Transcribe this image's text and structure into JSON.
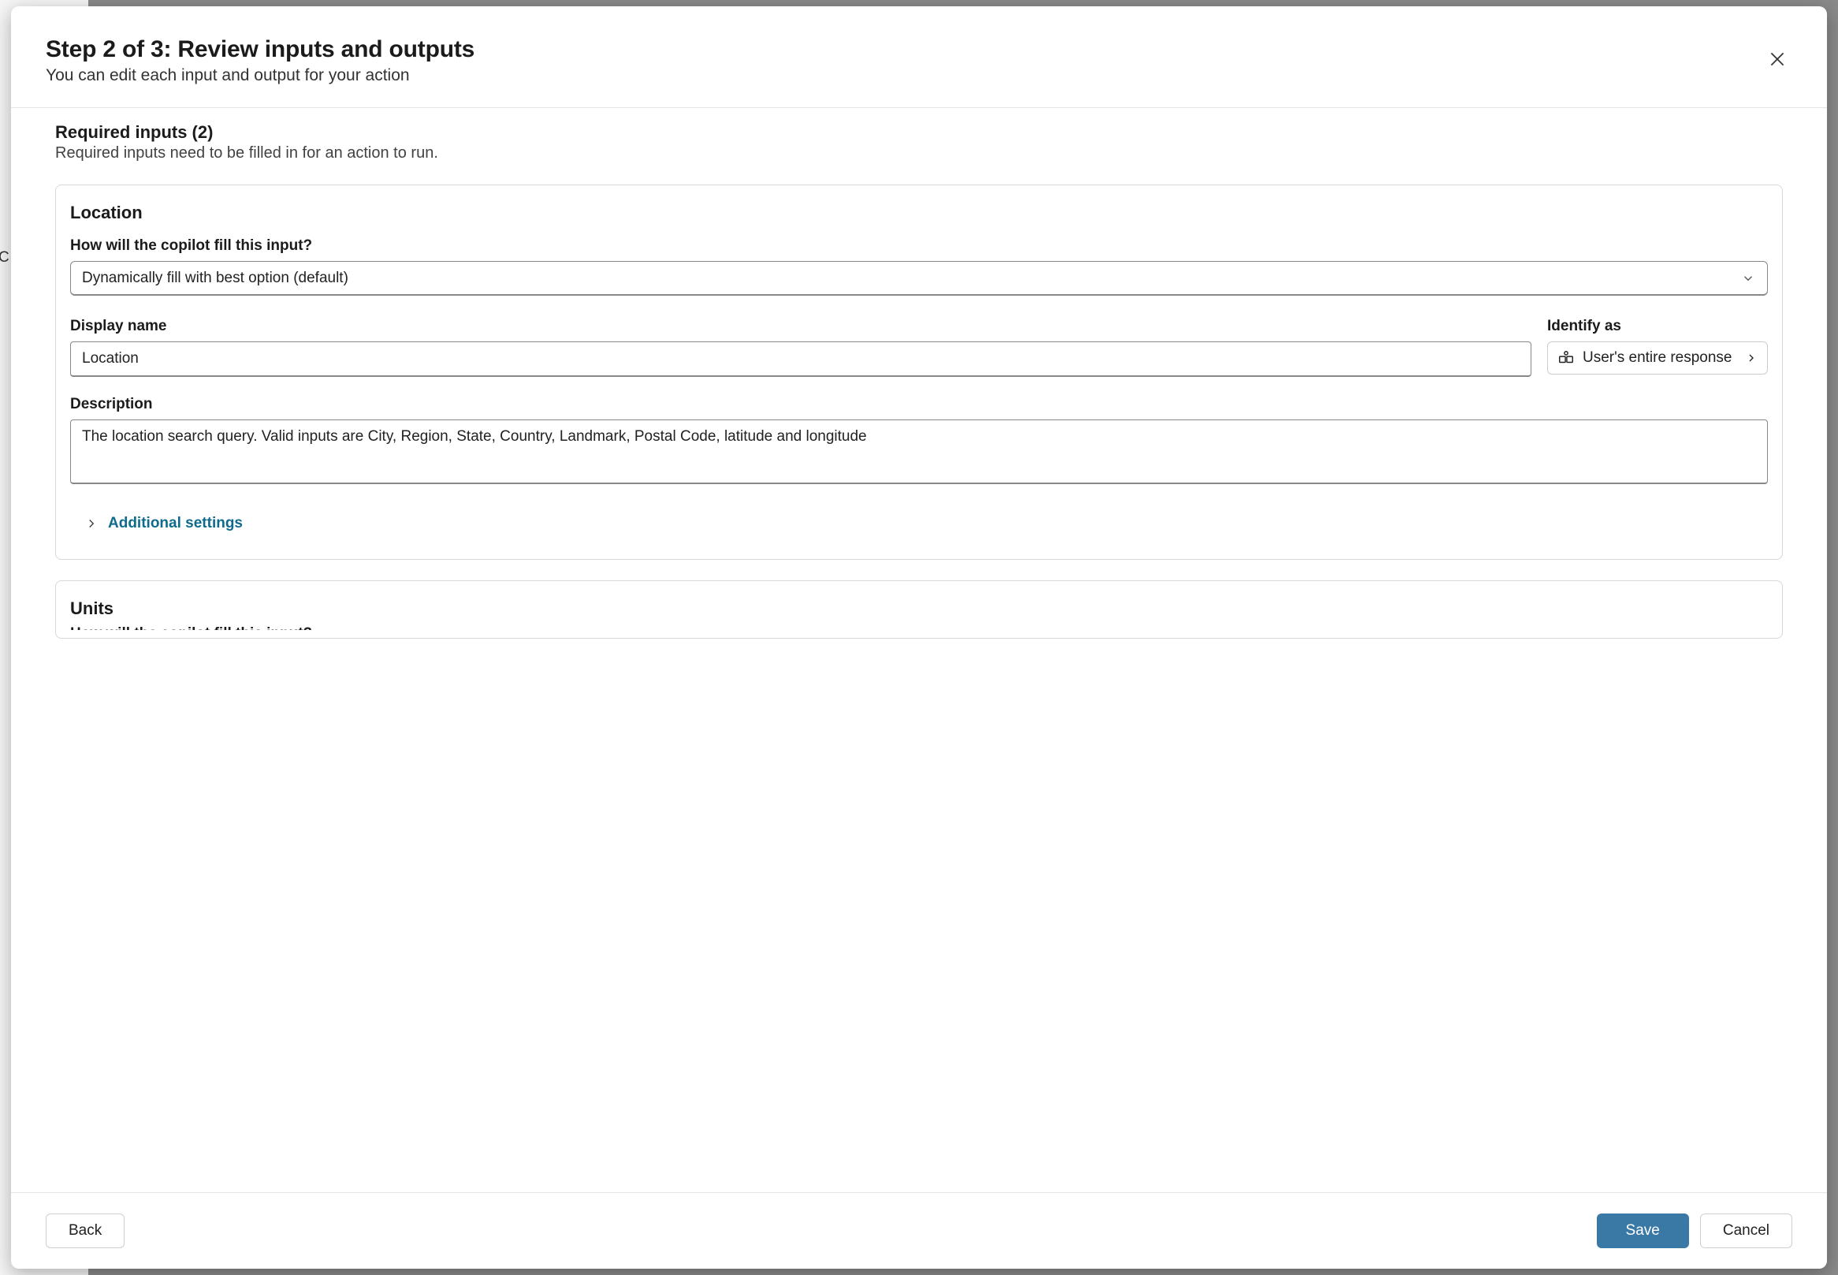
{
  "header": {
    "title": "Step 2 of 3: Review inputs and outputs",
    "subtitle": "You can edit each input and output for your action"
  },
  "section": {
    "title": "Required inputs (2)",
    "subtitle": "Required inputs need to be filled in for an action to run."
  },
  "labels": {
    "fill_method": "How will the copilot fill this input?",
    "display_name": "Display name",
    "identify_as": "Identify as",
    "description": "Description",
    "additional_settings": "Additional settings"
  },
  "inputs": [
    {
      "name": "Location",
      "fill_method": "Dynamically fill with best option (default)",
      "display_name": "Location",
      "identify_as": "User's entire response",
      "description": "The location search query. Valid inputs are City, Region, State, Country, Landmark, Postal Code, latitude and longitude"
    },
    {
      "name": "Units"
    }
  ],
  "footer": {
    "back": "Back",
    "save": "Save",
    "cancel": "Cancel"
  }
}
